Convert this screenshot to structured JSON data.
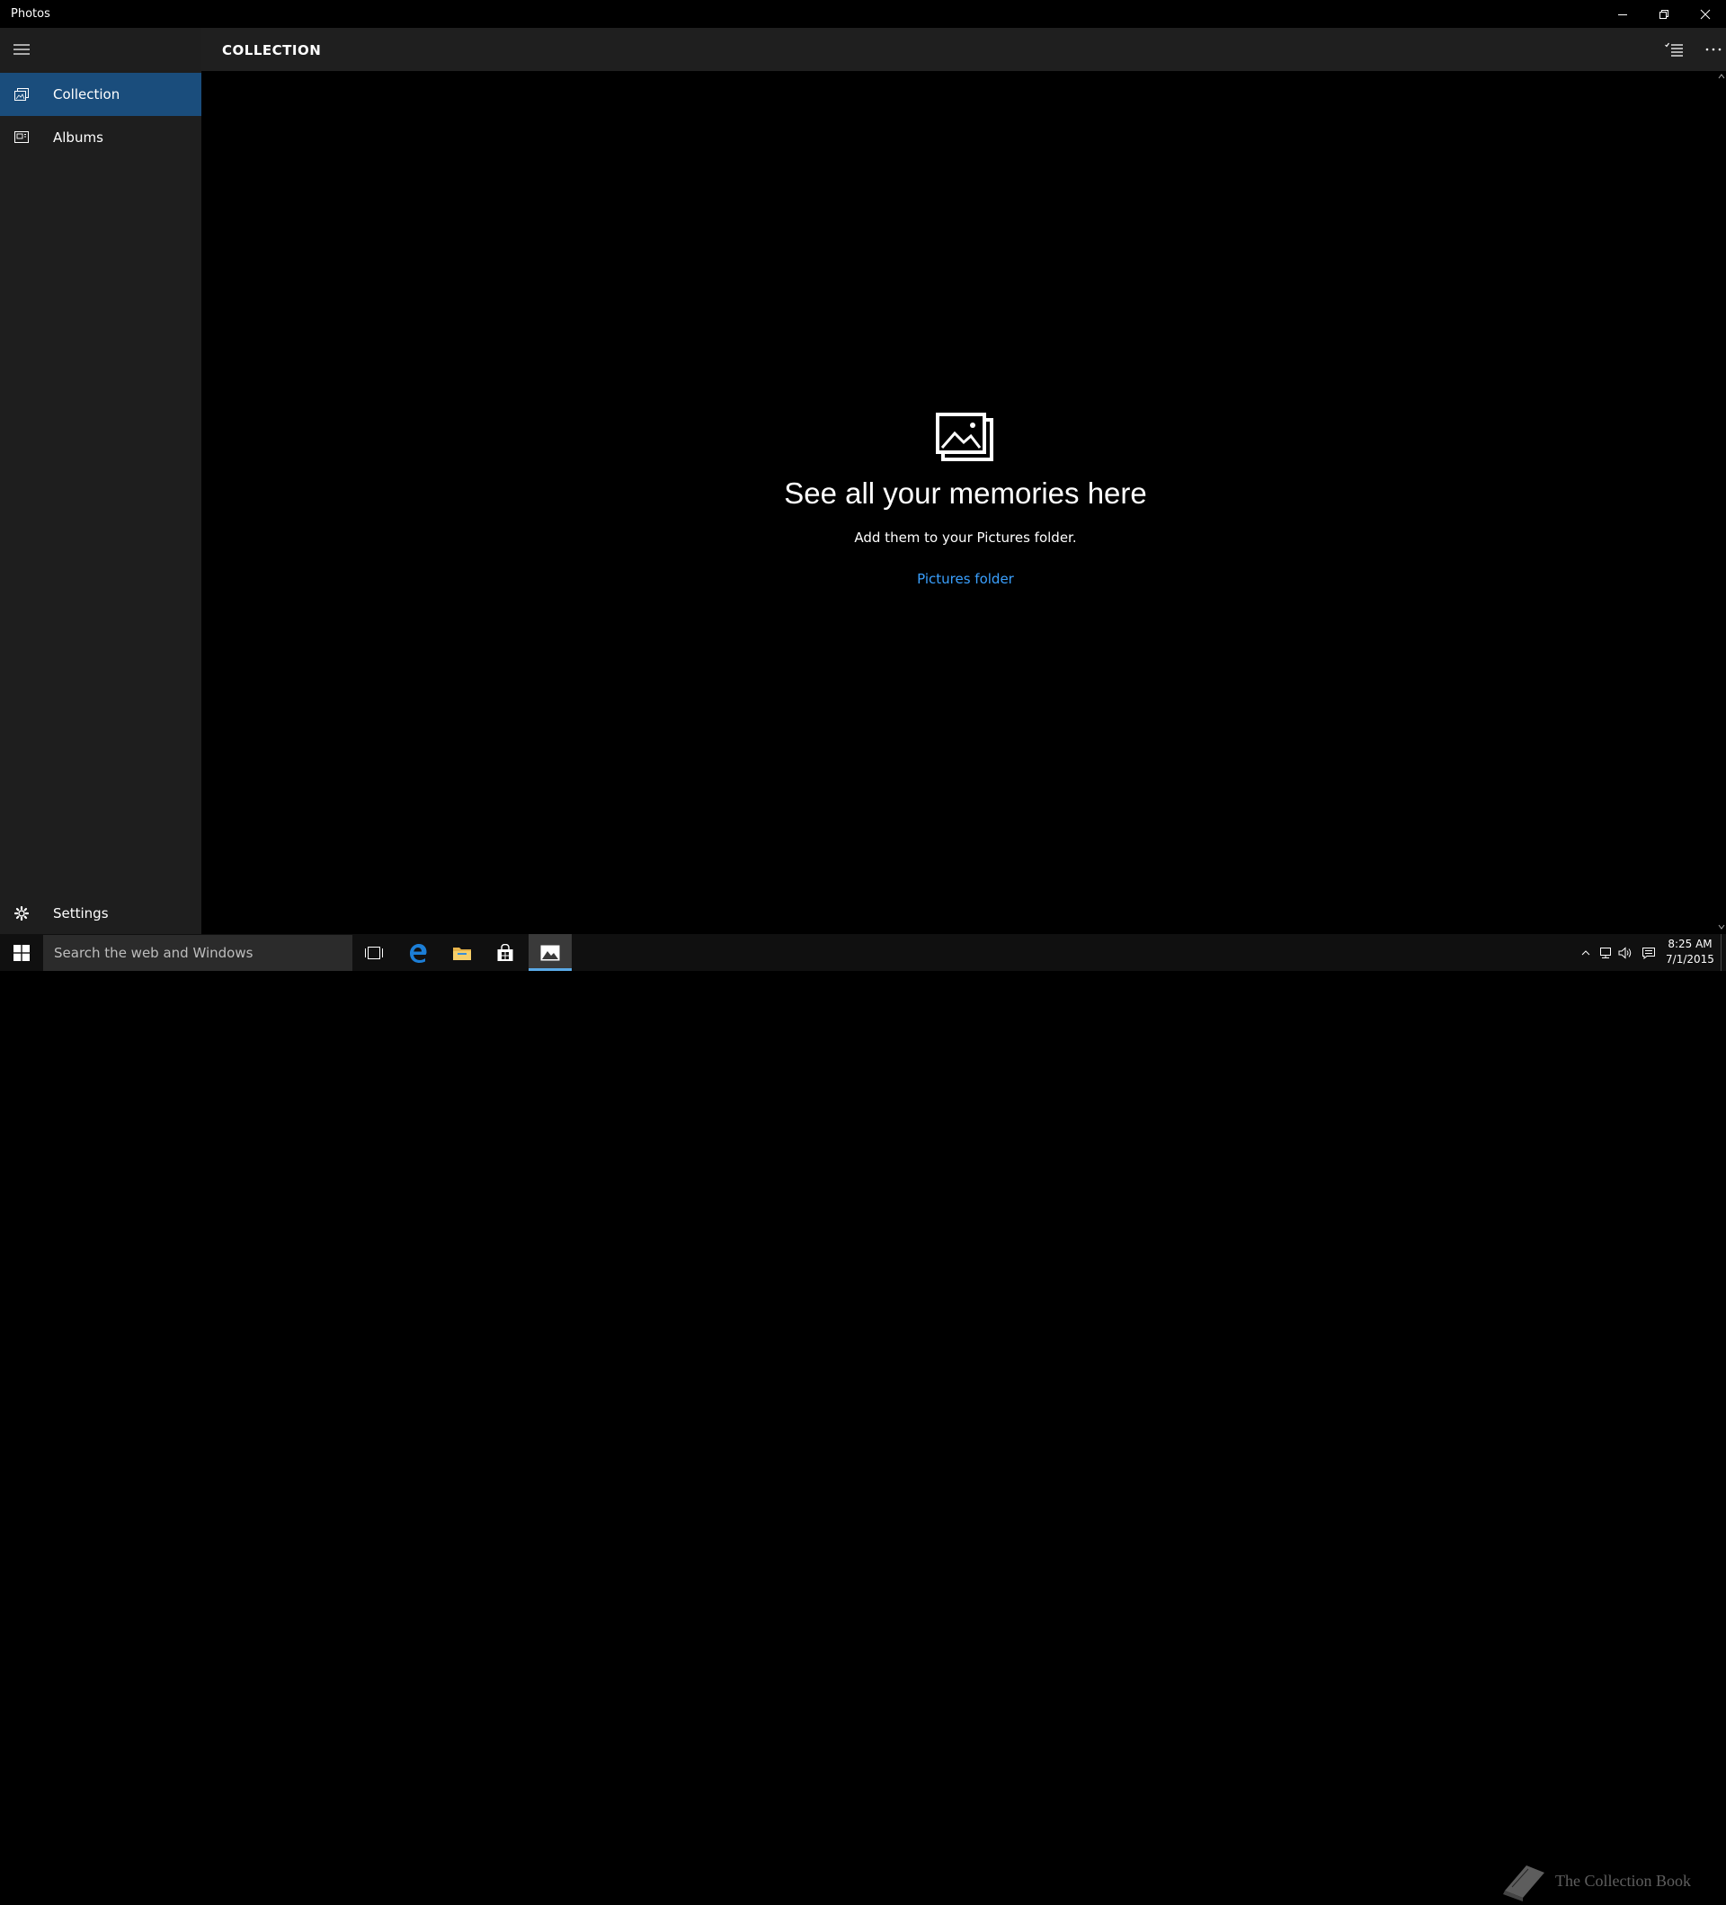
{
  "window": {
    "title": "Photos",
    "icons": {
      "minimize": "minimize-icon",
      "restore": "restore-icon",
      "close": "close-icon"
    }
  },
  "sidebar": {
    "menu_icon": "hamburger-icon",
    "items": [
      {
        "label": "Collection",
        "icon": "collection-icon",
        "active": true
      },
      {
        "label": "Albums",
        "icon": "albums-icon",
        "active": false
      }
    ],
    "settings": {
      "label": "Settings",
      "icon": "gear-icon"
    }
  },
  "header": {
    "title": "COLLECTION",
    "select_icon": "select-list-icon",
    "more_icon": "more-icon"
  },
  "empty_state": {
    "icon": "photos-stack-icon",
    "title": "See all your memories here",
    "subtitle": "Add them to your Pictures folder.",
    "link": "Pictures folder"
  },
  "taskbar": {
    "search_placeholder": "Search the web and Windows",
    "apps": [
      "task-view-icon",
      "edge-icon",
      "file-explorer-icon",
      "store-icon",
      "photos-app-icon"
    ],
    "tray_icons": [
      "chevron-up-icon",
      "network-icon",
      "volume-icon",
      "notification-icon"
    ],
    "time": "8:25 AM",
    "date": "7/1/2015"
  },
  "watermark": {
    "text": "The Collection Book"
  },
  "colors": {
    "accent": "#1a4d7c",
    "link": "#3aa0ff",
    "sidebar_bg": "#1e1e1e",
    "header_bg": "#1f1f1f",
    "taskbar_bg": "#101010"
  }
}
